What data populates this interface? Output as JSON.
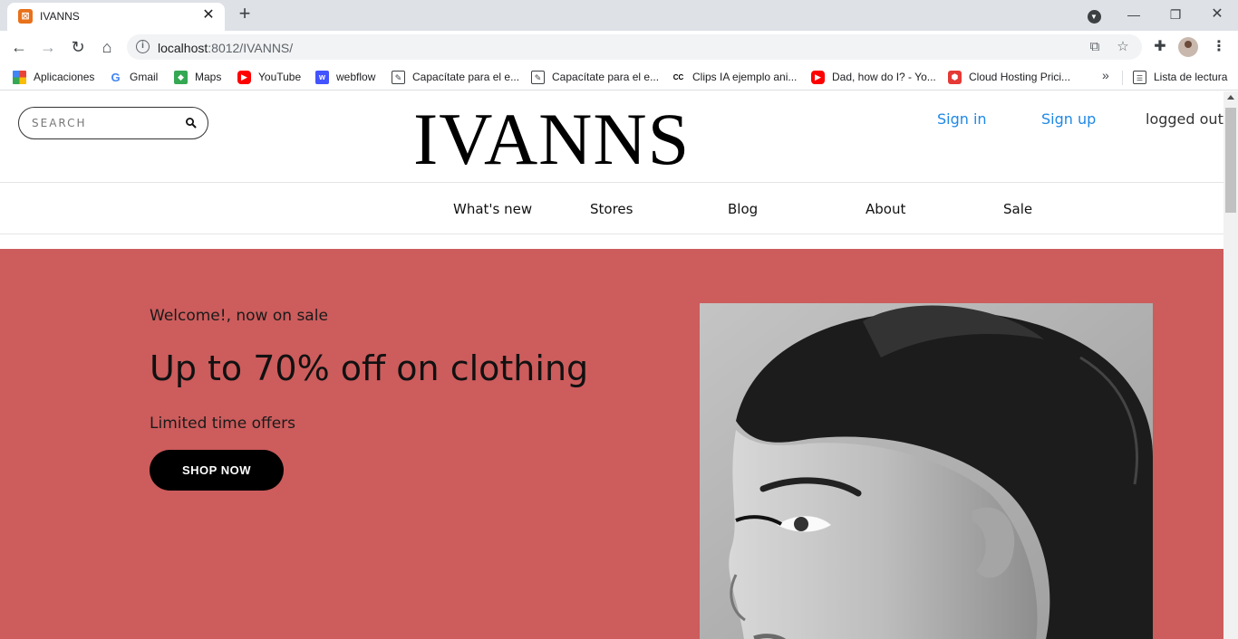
{
  "browser": {
    "tab_title": "IVANNS",
    "url_host": "localhost",
    "url_path": ":8012/IVANNS/",
    "bookmarks": [
      {
        "label": "Aplicaciones",
        "icon": "apps-grid-icon"
      },
      {
        "label": "Gmail",
        "icon": "google-icon"
      },
      {
        "label": "Maps",
        "icon": "maps-icon"
      },
      {
        "label": "YouTube",
        "icon": "youtube-icon"
      },
      {
        "label": "webflow",
        "icon": "webflow-icon"
      },
      {
        "label": "Capacítate para el e...",
        "icon": "edit-note-icon"
      },
      {
        "label": "Capacítate para el e...",
        "icon": "edit-note-icon"
      },
      {
        "label": "Clips IA ejemplo ani...",
        "icon": "cc-icon"
      },
      {
        "label": "Dad, how do I? - Yo...",
        "icon": "youtube-icon"
      },
      {
        "label": "Cloud Hosting Prici...",
        "icon": "cloud-hosting-icon"
      }
    ],
    "reading_list": "Lista de lectura"
  },
  "header": {
    "search_placeholder": "SEARCH",
    "logo": "IVANNS",
    "sign_in": "Sign in",
    "sign_up": "Sign up",
    "status": "logged out"
  },
  "nav": [
    "What's new",
    "Stores",
    "Blog",
    "About",
    "Sale"
  ],
  "hero": {
    "welcome": "Welcome!, now on sale",
    "headline": "Up to 70% off on clothing",
    "subtext": "Limited time offers",
    "cta": "SHOP NOW"
  },
  "colors": {
    "hero_bg": "#cd5c5c",
    "link": "#1e88e5",
    "button_bg": "#000000"
  }
}
